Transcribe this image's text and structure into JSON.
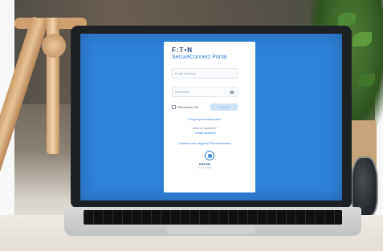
{
  "login": {
    "logo": "F:T•N",
    "title": "SecureConnect Portal",
    "email_placeholder": "Email Address",
    "password_placeholder": "Password",
    "remember_label": "Remember Me",
    "signin_label": "Sign In",
    "forgot_password": "Forgot your password?",
    "new_account_prompt": "New to account?",
    "create_account": "Create Account",
    "contact_support": "Contact your regional Representative",
    "brand": "EATON",
    "version": "v1.0.0 ©2022"
  },
  "colors": {
    "screen_bg": "#2f82d9",
    "brand_dark": "#1a3f7a",
    "signin_bg": "#cfe2f6"
  },
  "icons": {
    "password_toggle": "eye-icon",
    "emblem": "eaton-emblem-icon"
  }
}
